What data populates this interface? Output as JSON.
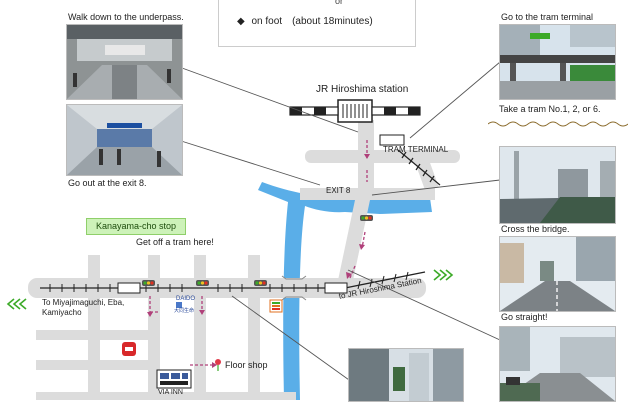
{
  "info": {
    "or_label": "or",
    "bullet": "◆",
    "on_foot": "on foot　(about 18minutes)"
  },
  "labels": {
    "walk_down": "Walk down to the underpass.",
    "exit_text": "Go out at the exit 8.",
    "station": "JR Hiroshima station",
    "tram_terminal": "TRAM TERMINAL",
    "exit8": "EXIT 8",
    "kanayama_stop": "Kanayama-cho stop",
    "get_off": "Get off a tram here!",
    "to_miyajima_line1": "To Miyajimaguchi, Eba,",
    "to_miyajima_line2": "Kamiyacho",
    "to_jr": "to JR Hiroshima Station",
    "floor_shop": "Floor shop",
    "via_inn": "VIA INN",
    "daido": "DAIDO",
    "daido_sub": "大同生命",
    "go_tram_terminal": "Go to the tram terminal",
    "take_tram": "Take a tram No.1, 2, or 6.",
    "cross_bridge": "Cross the bridge.",
    "go_straight": "Go straight!"
  },
  "colors": {
    "road": "#dcdcdc",
    "river": "#5aaee8",
    "rail": "#222222",
    "walk_route": "#b0407a",
    "green_arrow": "#3caa28",
    "stop_box": "#cdf2b9"
  }
}
